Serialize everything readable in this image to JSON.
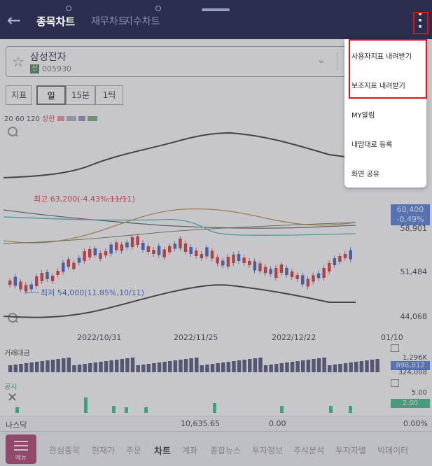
{
  "header": {
    "back_icon": "arrow-left-icon",
    "tabs": [
      {
        "label": "종목차트",
        "active": true
      },
      {
        "label": "재무차트",
        "active": false
      },
      {
        "label": "지수차트",
        "active": false
      }
    ],
    "more_icon": "more-vertical-icon"
  },
  "stock": {
    "name": "삼성전자",
    "badge": "신",
    "code": "005930"
  },
  "period": {
    "indicator_label": "지표",
    "options": [
      "일",
      "15분",
      "1틱"
    ],
    "selected": "일"
  },
  "legend": {
    "ma": "20 60 120",
    "upper": "상한"
  },
  "chart": {
    "high_annotation": "최고 63,200(-4.43%,11/11)",
    "low_annotation": "최저 54,000(11.85%,10/11)",
    "current_price": "60,400",
    "current_change": "-0.49%",
    "y_partial": "58,901",
    "y_mid": "51,484",
    "y_low": "44,068",
    "dates": [
      "2022/10/31",
      "2022/11/25",
      "2022/12/22",
      "01/10"
    ]
  },
  "volume": {
    "label": "거래대금",
    "top_value": "1,296K",
    "current": "898,812",
    "bottom_value": "324,008"
  },
  "disclosure": {
    "label": "공시",
    "top_value": "5.00",
    "current": "2.00"
  },
  "index_row": {
    "name": "나스닥",
    "value": "10,635.65",
    "change": "0.00",
    "rate": "0.00%"
  },
  "bottom_nav": {
    "menu_label": "메뉴",
    "items": [
      "관심종목",
      "현재가",
      "주문",
      "차트",
      "계좌",
      "종합뉴스",
      "투자정보",
      "주식분석",
      "투자자별",
      "빅데이터"
    ],
    "active": "차트"
  },
  "popup": {
    "items": [
      "사용자지표 내려받기",
      "보조지표 내려받기",
      "MY알림",
      "내맘대로 등록",
      "화면 공유"
    ]
  },
  "colors": {
    "header_bg": "#2b2e4e",
    "up": "#d22222",
    "down": "#2a4fb5",
    "highlight": "#e01010",
    "menu_btn": "#a2265a"
  }
}
